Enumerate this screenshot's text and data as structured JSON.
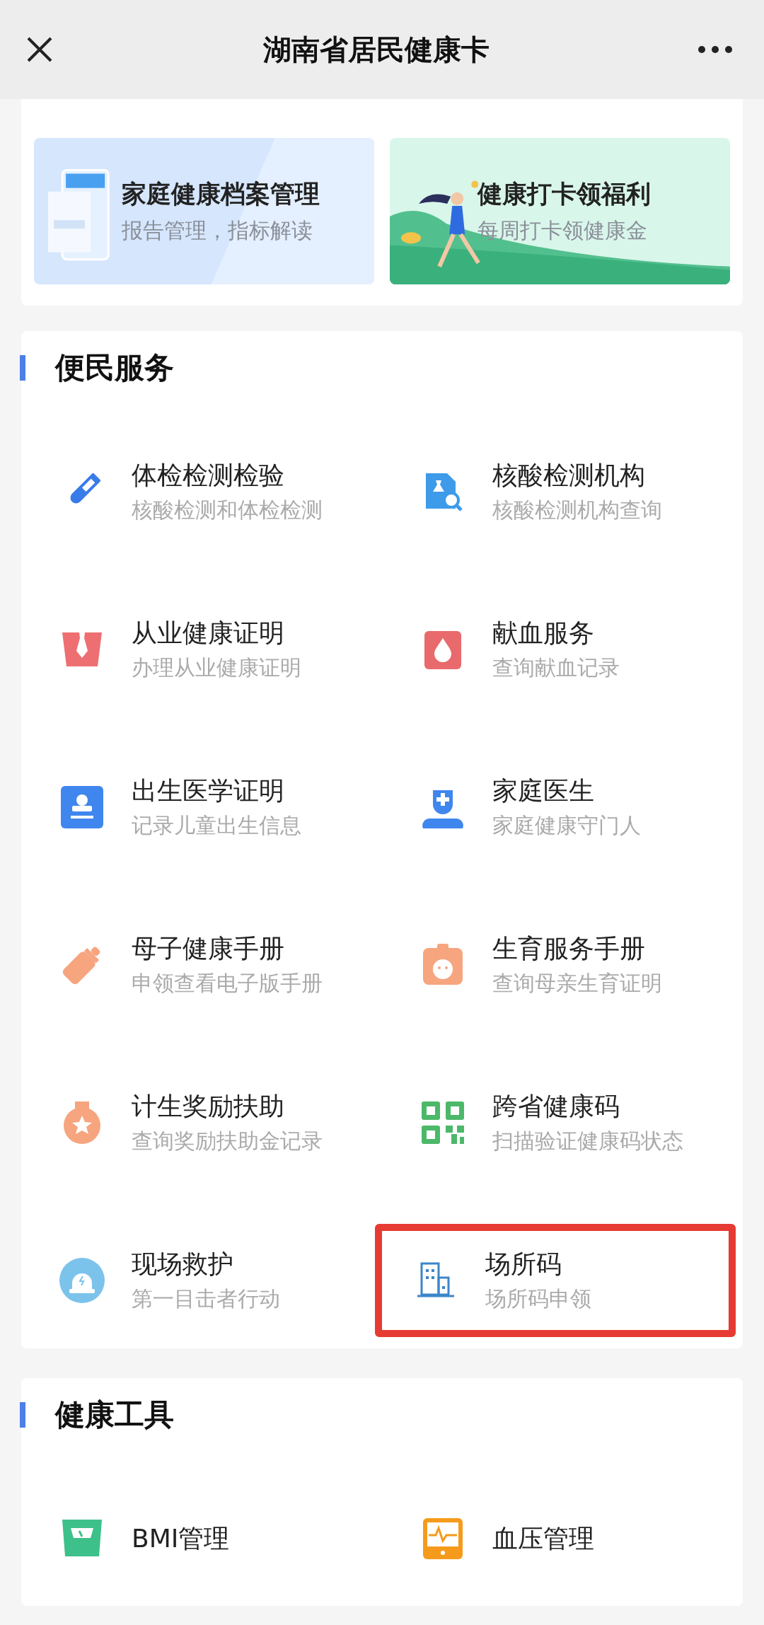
{
  "header": {
    "title": "湖南省居民健康卡"
  },
  "featured": [
    {
      "kind": "records",
      "title": "家庭健康档案管理",
      "subtitle": "报告管理，指标解读"
    },
    {
      "kind": "runner",
      "title": "健康打卡领福利",
      "subtitle": "每周打卡领健康金"
    }
  ],
  "sections": [
    {
      "title": "便民服务",
      "items": [
        {
          "kind": "tube",
          "title": "体检检测检验",
          "subtitle": "核酸检测和体检检测",
          "highlighted": false
        },
        {
          "kind": "lab",
          "title": "核酸检测机构",
          "subtitle": "核酸检测机构查询",
          "highlighted": false
        },
        {
          "kind": "tie",
          "title": "从业健康证明",
          "subtitle": "办理从业健康证明",
          "highlighted": false
        },
        {
          "kind": "drop",
          "title": "献血服务",
          "subtitle": "查询献血记录",
          "highlighted": false
        },
        {
          "kind": "stamp",
          "title": "出生医学证明",
          "subtitle": "记录儿童出生信息",
          "highlighted": false
        },
        {
          "kind": "doctor",
          "title": "家庭医生",
          "subtitle": "家庭健康守门人",
          "highlighted": false
        },
        {
          "kind": "bottle",
          "title": "母子健康手册",
          "subtitle": "申领查看电子版手册",
          "highlighted": false
        },
        {
          "kind": "baby",
          "title": "生育服务手册",
          "subtitle": "查询母亲生育证明",
          "highlighted": false
        },
        {
          "kind": "medal",
          "title": "计生奖励扶助",
          "subtitle": "查询奖励扶助金记录",
          "highlighted": false
        },
        {
          "kind": "qr",
          "title": "跨省健康码",
          "subtitle": "扫描验证健康码状态",
          "highlighted": false
        },
        {
          "kind": "sos",
          "title": "现场救护",
          "subtitle": "第一目击者行动",
          "highlighted": false
        },
        {
          "kind": "building",
          "title": "场所码",
          "subtitle": "场所码申领",
          "highlighted": true
        }
      ]
    },
    {
      "title": "健康工具",
      "items": [
        {
          "kind": "scale",
          "title": "BMI管理"
        },
        {
          "kind": "monitor",
          "title": "血压管理"
        }
      ]
    }
  ]
}
